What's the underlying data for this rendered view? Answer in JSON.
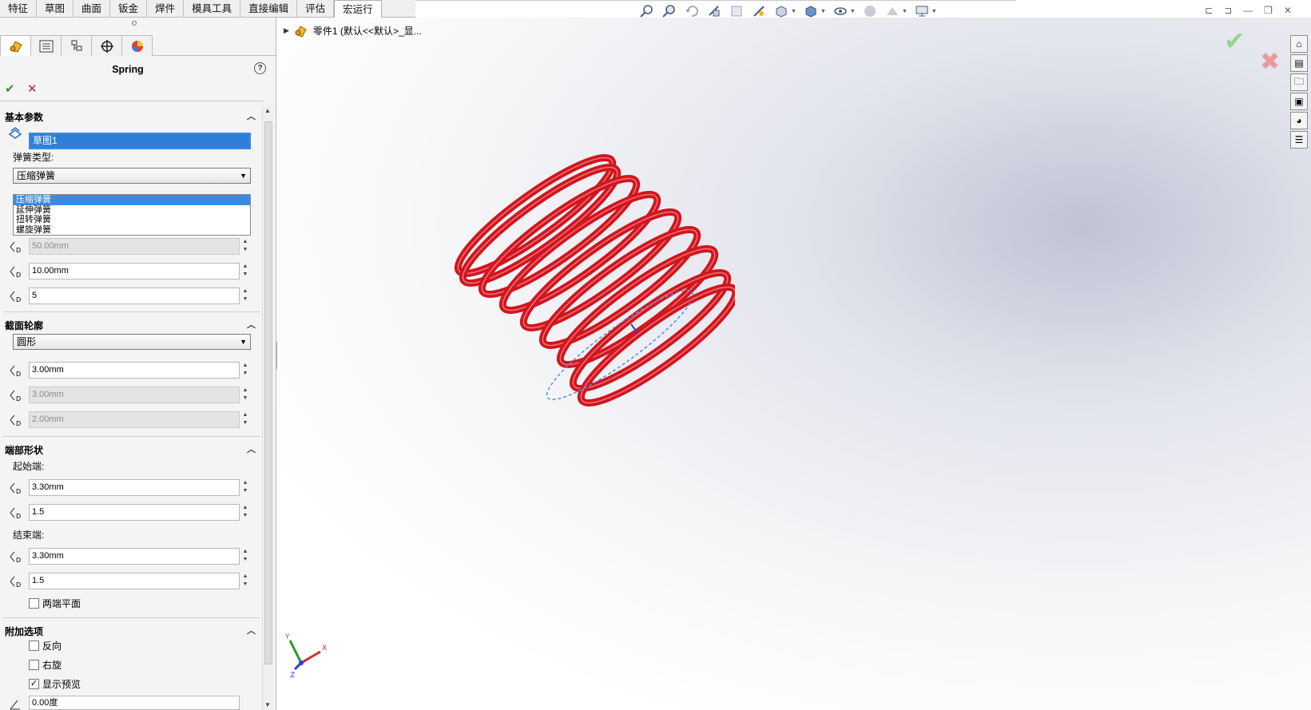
{
  "tabs": [
    "特征",
    "草图",
    "曲面",
    "钣金",
    "焊件",
    "模具工具",
    "直接编辑",
    "评估",
    "宏运行"
  ],
  "active_tab": "宏运行",
  "property_manager": {
    "title": "Spring",
    "help": "?",
    "ok": "✔",
    "cancel": "✕"
  },
  "basic": {
    "title": "基本参数",
    "sketch_value": "草图1",
    "spring_type_label": "弹簧类型:",
    "spring_type_selected": "压缩弹簧",
    "spring_type_options": [
      "压缩弹簧",
      "延伸弹簧",
      "扭转弹簧",
      "螺旋弹簧"
    ],
    "fields": [
      "50.00mm",
      "10.00mm",
      "5"
    ]
  },
  "profile": {
    "title": "截面轮廓",
    "shape": "圆形",
    "fields": [
      "3.00mm",
      "3.00mm",
      "2.00mm"
    ]
  },
  "ends": {
    "title": "端部形状",
    "start_label": "起始端:",
    "start_fields": [
      "3.30mm",
      "1.5"
    ],
    "end_label": "结束端:",
    "end_fields": [
      "3.30mm",
      "1.5"
    ],
    "flat_label": "两端平面"
  },
  "options": {
    "title": "附加选项",
    "reverse": "反向",
    "right_hand": "右旋",
    "show_preview": "显示预览",
    "angle": "0.00度"
  },
  "tree": {
    "label": "零件1  (默认<<默认>_显..."
  },
  "triad": {
    "x": "X",
    "y": "Y",
    "z": "Z"
  },
  "colors": {
    "spring": "#d0161e",
    "accent": "#3a8be0"
  }
}
